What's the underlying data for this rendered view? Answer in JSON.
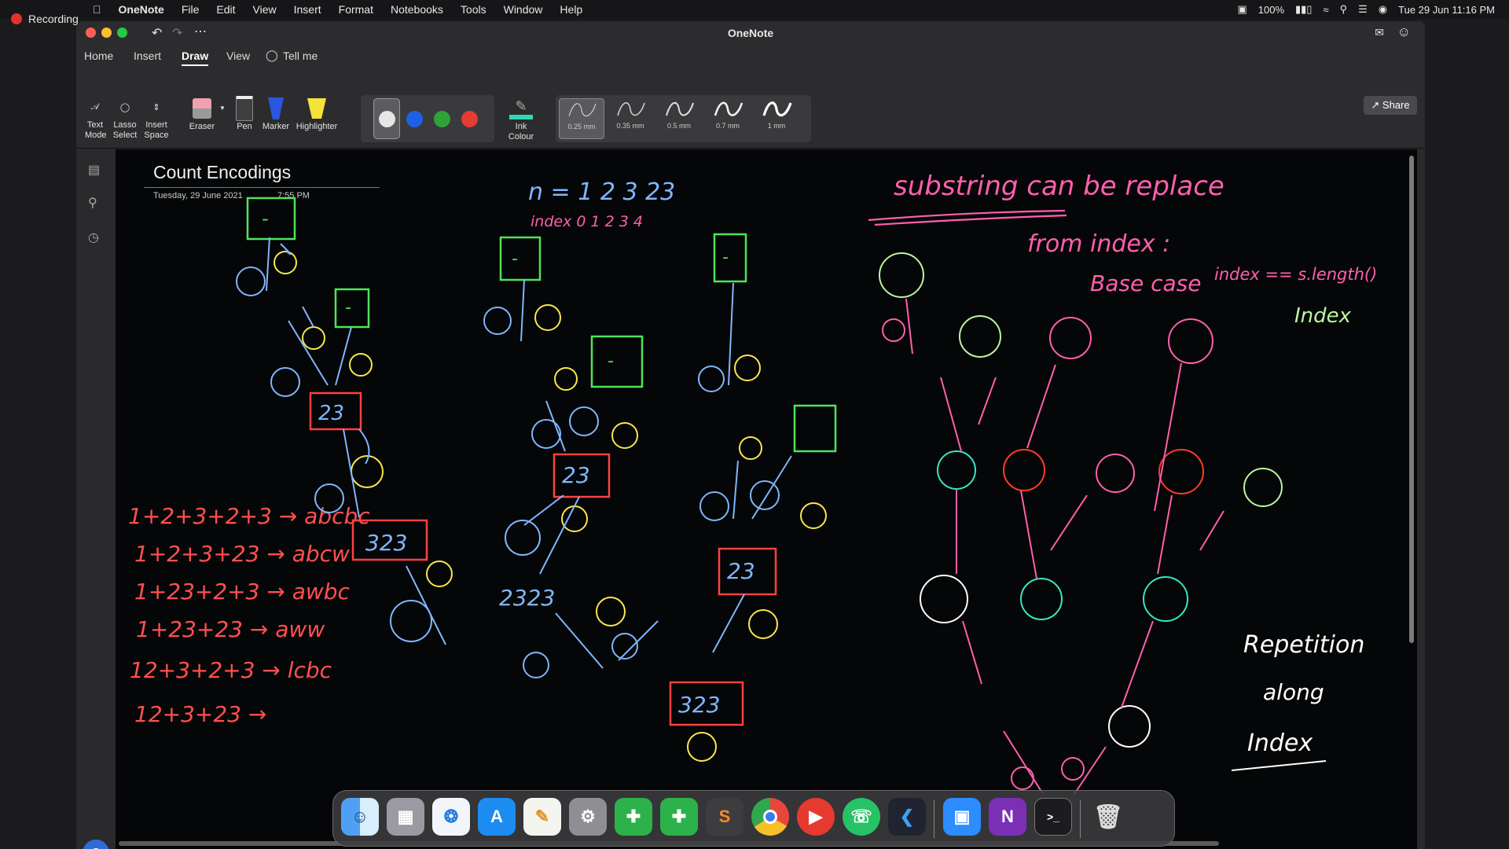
{
  "recording": {
    "label": "Recording"
  },
  "menubar": {
    "app": "OneNote",
    "items": [
      "File",
      "Edit",
      "View",
      "Insert",
      "Format",
      "Notebooks",
      "Tools",
      "Window",
      "Help"
    ],
    "battery": "100%",
    "datetime": "Tue 29 Jun  11:16 PM"
  },
  "window": {
    "title": "OneNote",
    "tabs": [
      "Home",
      "Insert",
      "Draw",
      "View"
    ],
    "active_tab": "Draw",
    "tell_me": "Tell me",
    "share": "Share"
  },
  "ribbon": {
    "text_mode": "Text Mode",
    "lasso_select": "Lasso Select",
    "insert_space": "Insert Space",
    "eraser": "Eraser",
    "pen": "Pen",
    "marker": "Marker",
    "highlighter": "Highlighter",
    "ink_colour": "Ink Colour",
    "thickness": [
      "0.25 mm",
      "0.35 mm",
      "0.5 mm",
      "0.7 mm",
      "1 mm"
    ],
    "colors": {
      "white": "#e6e6e6",
      "blue": "#1f5fe6",
      "green": "#2ea33a",
      "red": "#e53b35"
    }
  },
  "page": {
    "title": "Count Encodings",
    "date": "Tuesday, 29 June 2021",
    "time": "7:55 PM"
  },
  "ink": {
    "n_line": "n =  1  2  3  23",
    "index_line": "index  0   1   2   3   4",
    "heading": "substring can be replace",
    "from_index": "from  index :",
    "base_case": "Base case",
    "base_condition": "index == s.length()",
    "ind_x": "Index",
    "repetition": "Repetition",
    "along": "along",
    "index2": "Index",
    "enc": [
      "1+2+3+2+3 → abcbc",
      "1+2+3+23 → abcw",
      "1+23+2+3 → awbc",
      "1+23+23 → aww",
      "12+3+2+3 → lcbc",
      "12+3+23 →"
    ],
    "tree_boxes": [
      "-",
      "-",
      "-",
      "23",
      "-",
      "-",
      "323",
      "23",
      "23",
      "2323",
      "323"
    ]
  },
  "dock": {
    "avatar": "S",
    "apps": [
      "Finder",
      "Launchpad",
      "Safari",
      "App Store",
      "Notes",
      "System Preferences",
      "Numbers",
      "Numbers",
      "Sublime Text",
      "Chrome",
      "Player",
      "WhatsApp",
      "VS Code",
      "Zoom",
      "OneNote",
      "Terminal",
      "Trash"
    ]
  }
}
